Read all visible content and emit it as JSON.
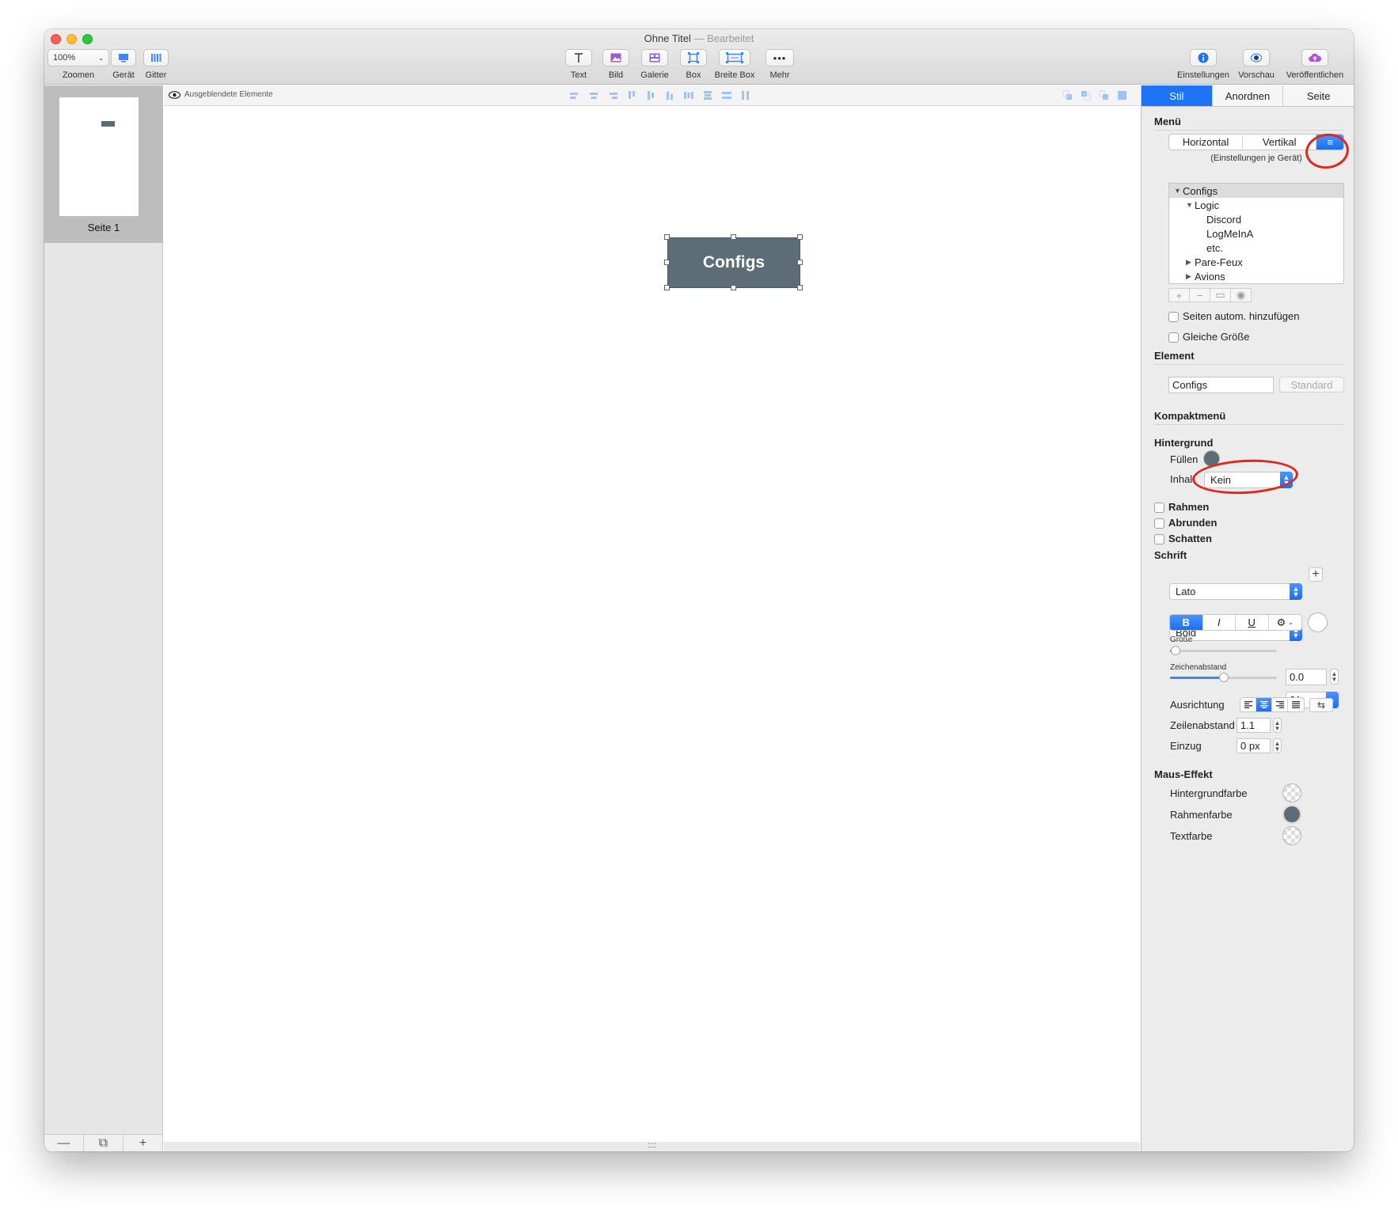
{
  "window": {
    "title": "Ohne Titel",
    "title_sep": " — ",
    "status": "Bearbeitet"
  },
  "toolbar": {
    "zoom_value": "100%",
    "left": [
      {
        "label": "Zoomen"
      },
      {
        "label": "Gerät"
      },
      {
        "label": "Gitter"
      }
    ],
    "insert": [
      {
        "label": "Text",
        "icon": "text-icon"
      },
      {
        "label": "Bild",
        "icon": "image-icon"
      },
      {
        "label": "Galerie",
        "icon": "gallery-icon"
      },
      {
        "label": "Box",
        "icon": "box-icon"
      },
      {
        "label": "Breite Box",
        "icon": "wide-box-icon"
      },
      {
        "label": "Mehr",
        "icon": "more-icon"
      }
    ],
    "right": [
      {
        "label": "Einstellungen",
        "icon": "info-icon"
      },
      {
        "label": "Vorschau",
        "icon": "eye-icon"
      },
      {
        "label": "Veröffentlichen",
        "icon": "upload-icon"
      }
    ]
  },
  "sidebar": {
    "page_label": "Seite 1",
    "footer": [
      "—",
      "⧉",
      "+"
    ]
  },
  "canvas": {
    "hidden_elements": "Ausgeblendete Elemente",
    "element_text": "Configs",
    "grip": "::::"
  },
  "inspector": {
    "tabs": [
      "Stil",
      "Anordnen",
      "Seite"
    ],
    "active_tab": "Stil",
    "menu": {
      "title": "Menü",
      "orientation": [
        "Horizontal",
        "Vertikal"
      ],
      "compact_icon": "≡",
      "note": "(Einstellungen je Gerät)",
      "tree": [
        {
          "label": "Configs",
          "level": 0,
          "toggle": "▼"
        },
        {
          "label": "Logic",
          "level": 1,
          "toggle": "▼"
        },
        {
          "label": "Discord",
          "level": 2,
          "toggle": ""
        },
        {
          "label": "LogMeInA",
          "level": 2,
          "toggle": ""
        },
        {
          "label": "etc.",
          "level": 2,
          "toggle": ""
        },
        {
          "label": "Pare-Feux",
          "level": 1,
          "toggle": "▶"
        },
        {
          "label": "Avions",
          "level": 1,
          "toggle": "▶"
        }
      ],
      "tree_tools": [
        "+",
        "−",
        "▭",
        "◉"
      ],
      "auto_pages": "Seiten autom. hinzufügen",
      "equal_size": "Gleiche Größe"
    },
    "element": {
      "title": "Element",
      "name_value": "Configs",
      "default_button": "Standard"
    },
    "compact_menu": {
      "title": "Kompaktmenü"
    },
    "background": {
      "title": "Hintergrund",
      "fill_label": "Füllen",
      "fill_color": "#5d6d78",
      "content_label": "Inhalt",
      "content_value": "Kein"
    },
    "toggles": [
      "Rahmen",
      "Abrunden",
      "Schatten"
    ],
    "font": {
      "title": "Schrift",
      "family": "Lato",
      "weight": "Bold",
      "styles": [
        "B",
        "I",
        "U",
        "⚙"
      ],
      "size_label": "Größe",
      "size_value": "21",
      "size_level": 0.05,
      "spacing_label": "Zeichenabstand",
      "spacing_value": "0.0",
      "spacing_level": 0.5,
      "align_label": "Ausrichtung",
      "line_label": "Zeilenabstand",
      "line_value": "1.1",
      "indent_label": "Einzug",
      "indent_value": "0 px"
    },
    "hover": {
      "title": "Maus-Effekt",
      "items": [
        "Hintergrundfarbe",
        "Rahmenfarbe",
        "Textfarbe"
      ],
      "border_color": "#5d6d78"
    }
  },
  "colors": {
    "accent": "#1d74f5",
    "annotation": "#e1261c",
    "element_bg": "#5d6d78"
  }
}
